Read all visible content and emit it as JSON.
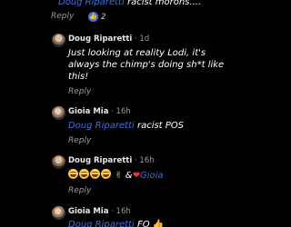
{
  "top_comment": {
    "mention": "Doug Riparetti",
    "text": " racist morons....",
    "reply_label": "Reply",
    "like_icon": "thumbs-up-icon",
    "like_count": "2"
  },
  "comment_1": {
    "author": "Doug Riparetti",
    "time": " · 1d",
    "line1": "Just looking at reality Lodi, it's",
    "line2": "always the chimp's doing sh*t like",
    "line3": "this!",
    "reply_label": "Reply"
  },
  "comment_2": {
    "author": "Gioia Mia",
    "time": " · 16h",
    "mention": "Doug Riparetti",
    "text": " racist POS",
    "reply_label": "Reply"
  },
  "comment_3": {
    "author": "Doug Riparetti",
    "time": " · 16h",
    "separator": "&",
    "mention": "Gioia",
    "reply_label": "Reply"
  },
  "comment_4": {
    "author": "Gioia Mia",
    "time": " · 16h",
    "mention": "Doug Riparetti",
    "text": " FO"
  }
}
